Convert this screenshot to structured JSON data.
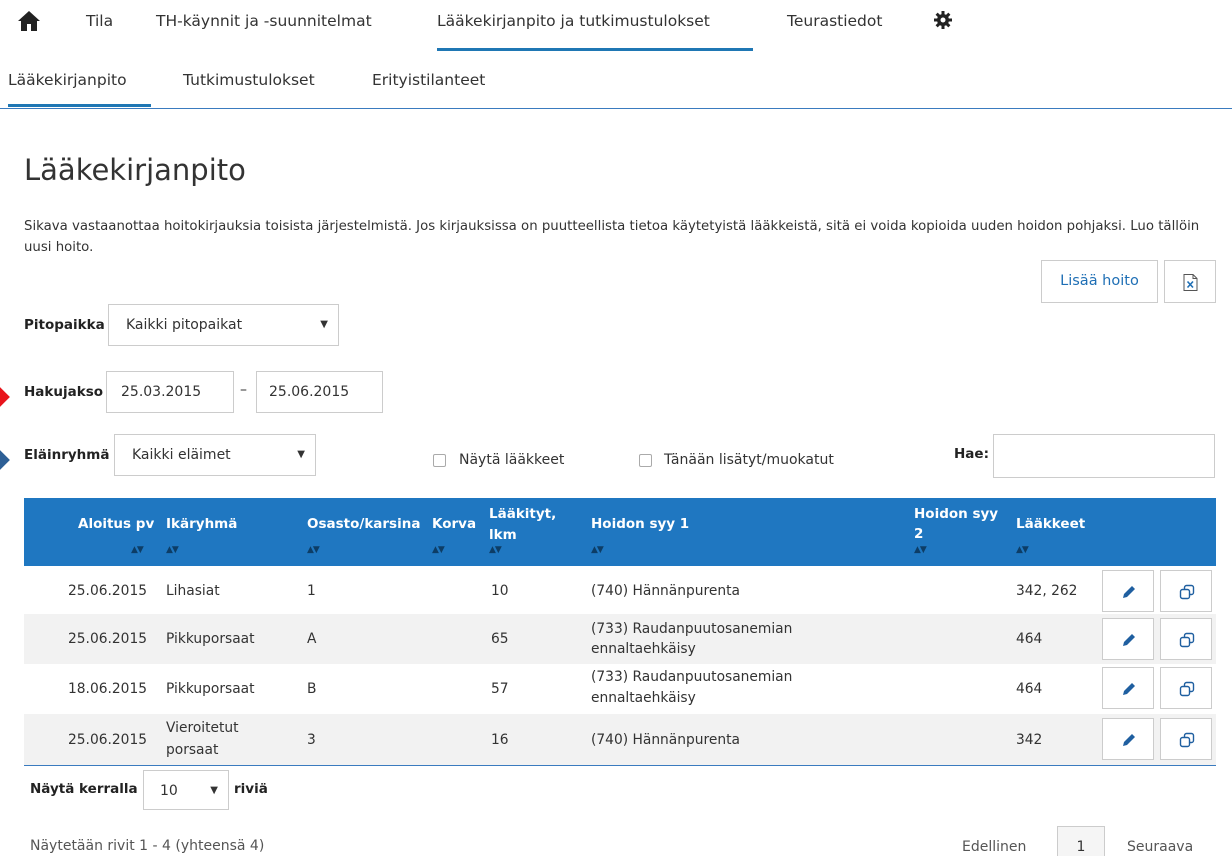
{
  "nav": {
    "tabs": [
      "Tila",
      "TH-käynnit ja -suunnitelmat",
      "Lääkekirjanpito ja tutkimustulokset",
      "Teurastiedot"
    ],
    "active_tab": 2
  },
  "subnav": {
    "tabs": [
      "Lääkekirjanpito",
      "Tutkimustulokset",
      "Erityistilanteet"
    ],
    "active_tab": 0
  },
  "page": {
    "title": "Lääkekirjanpito",
    "description": "Sikava vastaanottaa hoitokirjauksia toisista järjestelmistä. Jos kirjauksissa on puutteellista tietoa käytetyistä lääkkeistä, sitä ei voida kopioida uuden hoidon pohjaksi. Luo tällöin uusi hoito."
  },
  "toolbar": {
    "add_label": "Lisää hoito"
  },
  "filters": {
    "pitopaikka_label": "Pitopaikka",
    "pitopaikka_value": "Kaikki pitopaikat",
    "hakujakso_label": "Hakujakso",
    "date_from": "25.03.2015",
    "date_separator": "–",
    "date_to": "25.06.2015",
    "elainryhma_label": "Eläinryhmä",
    "elainryhma_value": "Kaikki eläimet",
    "show_meds_label": "Näytä lääkkeet",
    "today_label": "Tänään lisätyt/muokatut",
    "search_label": "Hae:",
    "search_value": ""
  },
  "table": {
    "columns": {
      "aloitus": "Aloitus pv",
      "ikaryhma": "Ikäryhmä",
      "osasto": "Osasto/karsina",
      "korva": "Korva",
      "laakityt1": "Lääkityt,",
      "laakityt2": "lkm",
      "syy1": "Hoidon syy 1",
      "syy2a": "Hoidon syy",
      "syy2b": "2",
      "laakkeet": "Lääkkeet"
    },
    "sort_icon": "▲▼",
    "rows": [
      {
        "date": "25.06.2015",
        "age1": "Lihasiat",
        "age2": "",
        "osasto": "1",
        "korva": "",
        "count": "10",
        "syy1a": "(740) Hännänpurenta",
        "syy1b": "",
        "syy2": "",
        "meds": "342, 262"
      },
      {
        "date": "25.06.2015",
        "age1": "Pikkuporsaat",
        "age2": "",
        "osasto": "A",
        "korva": "",
        "count": "65",
        "syy1a": "(733) Raudanpuutosanemian",
        "syy1b": "ennaltaehkäisy",
        "syy2": "",
        "meds": "464"
      },
      {
        "date": "18.06.2015",
        "age1": "Pikkuporsaat",
        "age2": "",
        "osasto": "B",
        "korva": "",
        "count": "57",
        "syy1a": "(733) Raudanpuutosanemian",
        "syy1b": "ennaltaehkäisy",
        "syy2": "",
        "meds": "464"
      },
      {
        "date": "25.06.2015",
        "age1": "Vieroitetut",
        "age2": "porsaat",
        "osasto": "3",
        "korva": "",
        "count": "16",
        "syy1a": "(740) Hännänpurenta",
        "syy1b": "",
        "syy2": "",
        "meds": "342"
      }
    ]
  },
  "pagination": {
    "show_label": "Näytä kerralla",
    "rows_value": "10",
    "rows_suffix": "riviä",
    "info": "Näytetään rivit 1 - 4 (yhteensä 4)",
    "prev": "Edellinen",
    "page": "1",
    "next": "Seuraava"
  },
  "icons": {
    "home": "home-icon",
    "settings": "gear-icon",
    "excel": "excel-export-icon",
    "edit": "pencil-icon",
    "copy": "copy-icon"
  },
  "colors": {
    "accent": "#1f77c1",
    "marker_red": "#e8141c",
    "marker_blue": "#2d5f96"
  }
}
